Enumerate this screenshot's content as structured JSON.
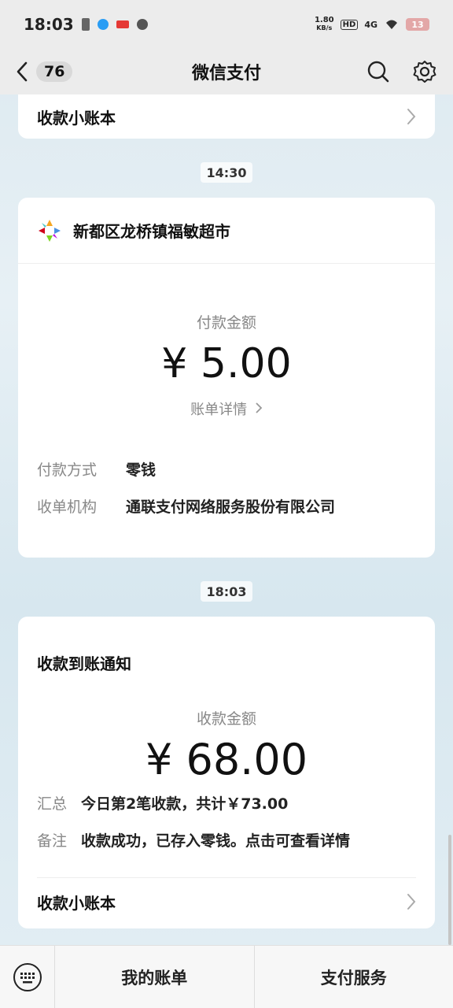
{
  "status_bar": {
    "time": "18:03",
    "net_speed_value": "1.80",
    "net_speed_unit": "KB/s",
    "hd_badge": "HD",
    "network": "4G",
    "battery": "13"
  },
  "nav": {
    "back_count": "76",
    "title": "微信支付"
  },
  "top_card": {
    "ledger_label": "收款小账本"
  },
  "time_chip_1": "14:30",
  "payment_card": {
    "merchant_name": "新都区龙桥镇福敏超市",
    "amount_label": "付款金额",
    "amount": "¥ 5.00",
    "bill_detail_label": "账单详情",
    "method_key": "付款方式",
    "method_value": "零钱",
    "institution_key": "收单机构",
    "institution_value": "通联支付网络服务股份有限公司"
  },
  "time_chip_2": "18:03",
  "receipt_card": {
    "title": "收款到账通知",
    "amount_label": "收款金额",
    "amount": "¥ 68.00",
    "summary_key": "汇总",
    "summary_value": "今日第2笔收款，共计￥73.00",
    "note_key": "备注",
    "note_value": "收款成功，已存入零钱。点击可查看详情",
    "ledger_label": "收款小账本"
  },
  "bottom_bar": {
    "my_bills": "我的账单",
    "pay_services": "支付服务"
  },
  "colors": {
    "nav_bg": "#ececec",
    "card_bg": "#ffffff",
    "muted_text": "#888888"
  }
}
